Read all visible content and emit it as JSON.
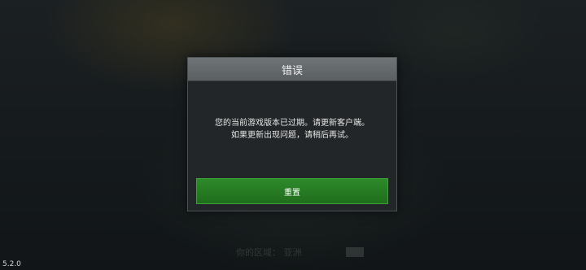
{
  "dialog": {
    "title": "错误",
    "message_line1": "您的当前游戏版本已过期。请更新客户端。",
    "message_line2": "如果更新出现问题，请稍后再试。",
    "button_label": "重置"
  },
  "background": {
    "server_region": "你的区域： 亚洲"
  },
  "version": "5.2.0"
}
